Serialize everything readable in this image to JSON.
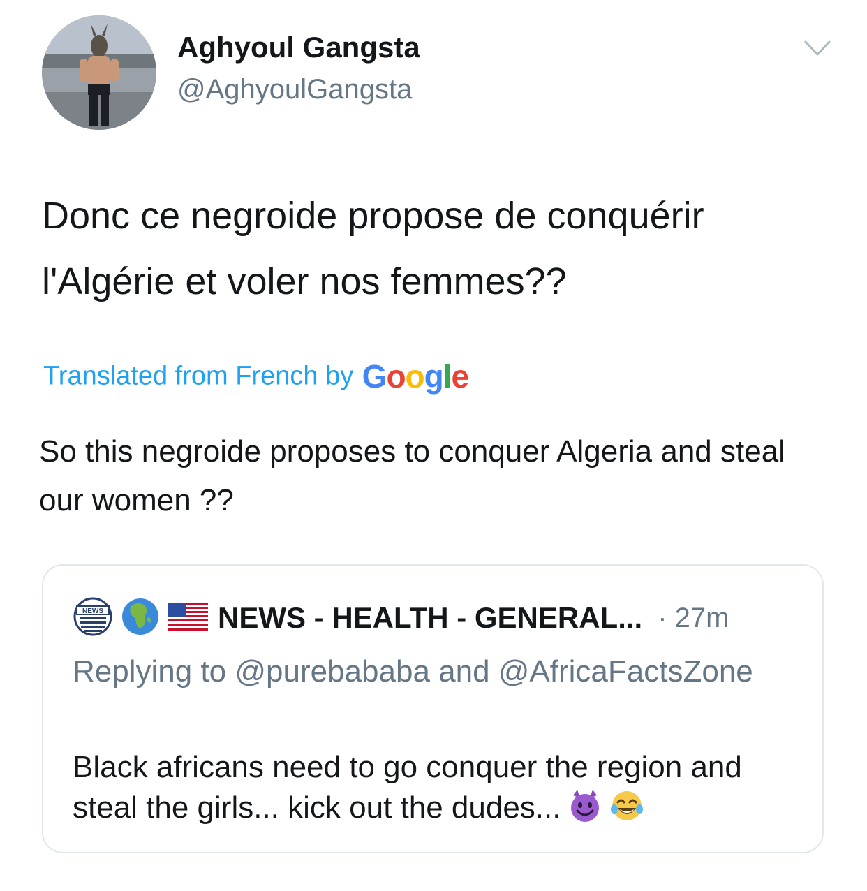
{
  "tweet": {
    "display_name": "Aghyoul Gangsta",
    "handle": "@AghyoulGangsta",
    "menu_icon": "chevron-down-icon",
    "text": "Donc ce negroide propose de conquérir l'Algérie et voler nos femmes??",
    "translation_label": "Translated from French by",
    "translation_provider": "Google",
    "translated_text": "So this negroide proposes to conquer Algeria and steal our women ??"
  },
  "quoted_tweet": {
    "icons": [
      "news-icon",
      "globe-africa-icon",
      "us-flag-icon"
    ],
    "display_name": "NEWS - HEALTH - GENERAL...",
    "time": "· 27m",
    "replying_to": "Replying to @purebababa and @AfricaFactsZone",
    "text": "Black africans need to go conquer the region and steal the girls... kick out the dudes...",
    "emojis": [
      "smiling-imp-icon",
      "tears-of-joy-icon"
    ]
  },
  "colors": {
    "link_blue": "#1da1f2",
    "text_primary": "#14171a",
    "text_secondary": "#657786",
    "border": "#e1e8ed"
  }
}
